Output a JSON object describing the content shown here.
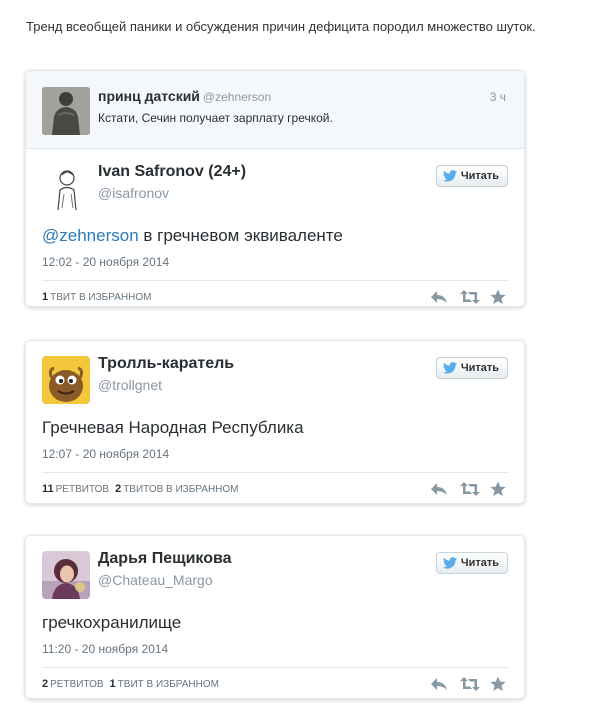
{
  "intro": "Тренд всеобщей паники и обсуждения причин дефицита породил множество шуток.",
  "follow_label": "Читать",
  "colors": {
    "link": "#2b7bb9",
    "twitter_blue": "#55acee",
    "muted": "#8899a6",
    "action_icon": "#8899a6"
  },
  "tweets": [
    {
      "quoted": {
        "name": "принц датский",
        "handle": "@zehnerson",
        "time": "3 ч",
        "text": "Кстати, Сечин получает зарплату гречкой."
      },
      "name": "Ivan Safronov (24+)",
      "handle": "@isafronov",
      "mention": "@zehnerson",
      "text": " в гречневом эквиваленте",
      "date": "12:02 - 20 ноября 2014",
      "stat1_num": "1",
      "stat1_label": "твит в избранном",
      "stat2_num": "",
      "stat2_label": ""
    },
    {
      "name": "Тролль-каратель",
      "handle": "@trollgnet",
      "text": "Гречневая Народная Республика",
      "date": "12:07 - 20 ноября 2014",
      "stat1_num": "11",
      "stat1_label": "ретвитов",
      "stat2_num": "2",
      "stat2_label": "твитов в избранном"
    },
    {
      "name": "Дарья Пещикова",
      "handle": "@Chateau_Margo",
      "text": "гречкохранилище",
      "date": "11:20 - 20 ноября 2014",
      "stat1_num": "2",
      "stat1_label": "ретвитов",
      "stat2_num": "1",
      "stat2_label": "твит в избранном"
    }
  ]
}
